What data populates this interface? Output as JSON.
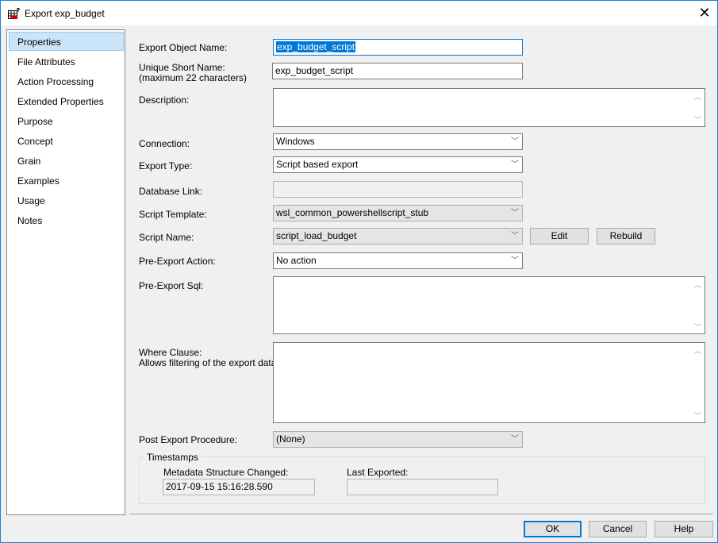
{
  "window": {
    "title": "Export exp_budget",
    "close_icon": "close-icon",
    "accent": "#0078d7"
  },
  "sidebar": {
    "items": [
      {
        "label": "Properties",
        "selected": true
      },
      {
        "label": "File Attributes"
      },
      {
        "label": "Action Processing"
      },
      {
        "label": "Extended Properties"
      },
      {
        "label": "Purpose"
      },
      {
        "label": "Concept"
      },
      {
        "label": "Grain"
      },
      {
        "label": "Examples"
      },
      {
        "label": "Usage"
      },
      {
        "label": "Notes"
      }
    ]
  },
  "form": {
    "export_object_name": {
      "label": "Export Object Name:",
      "value": "exp_budget_script"
    },
    "unique_short_name": {
      "label": "Unique Short Name:",
      "sublabel": "(maximum 22 characters)",
      "value": "exp_budget_script"
    },
    "description": {
      "label": "Description:",
      "value": ""
    },
    "connection": {
      "label": "Connection:",
      "value": "Windows"
    },
    "export_type": {
      "label": "Export Type:",
      "value": "Script based export"
    },
    "database_link": {
      "label": "Database Link:",
      "value": ""
    },
    "script_template": {
      "label": "Script Template:",
      "value": "wsl_common_powershellscript_stub"
    },
    "script_name": {
      "label": "Script Name:",
      "value": "script_load_budget",
      "edit": "Edit",
      "rebuild": "Rebuild"
    },
    "pre_export_action": {
      "label": "Pre-Export Action:",
      "value": "No action"
    },
    "pre_export_sql": {
      "label": "Pre-Export Sql:",
      "value": ""
    },
    "where_clause": {
      "label": "Where Clause:",
      "sublabel": "Allows filtering of the export data.",
      "value": ""
    },
    "post_export_procedure": {
      "label": "Post Export Procedure:",
      "value": "(None)"
    }
  },
  "timestamps": {
    "title": "Timestamps",
    "metadata_label": "Metadata Structure Changed:",
    "metadata_value": "2017-09-15 15:16:28.590",
    "last_exported_label": "Last Exported:",
    "last_exported_value": ""
  },
  "buttons": {
    "ok": "OK",
    "cancel": "Cancel",
    "help": "Help"
  }
}
